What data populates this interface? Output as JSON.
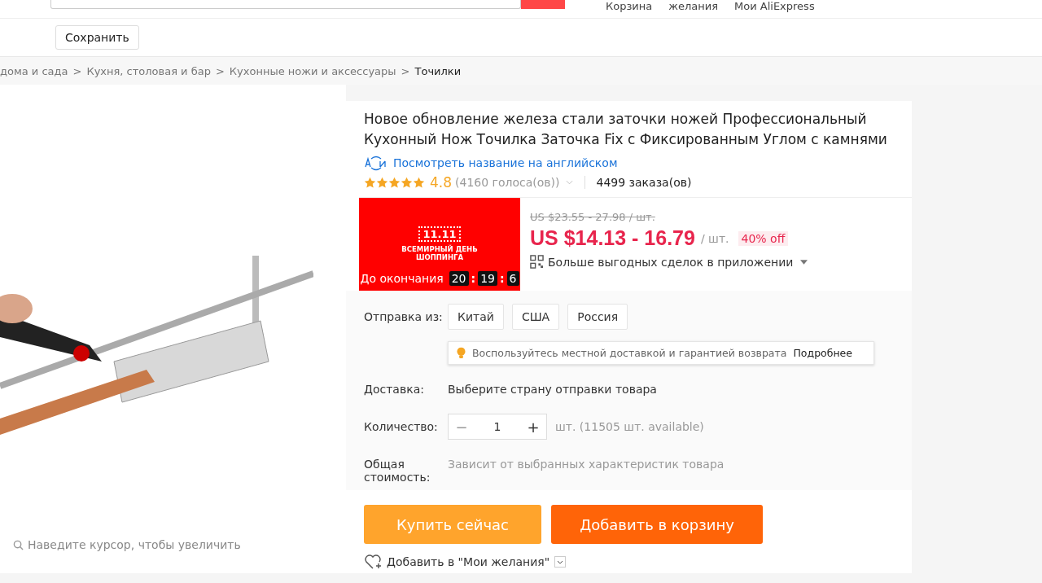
{
  "header": {
    "links": [
      {
        "label": "Корзина"
      },
      {
        "label": "желания"
      },
      {
        "label": "Мои AliExpress"
      }
    ]
  },
  "toolbar": {
    "save_button": "Сохранить"
  },
  "breadcrumb": [
    "дома и сада",
    "Кухня, столовая и бар",
    "Кухонные ножи и аксессуары",
    "Точилки"
  ],
  "breadcrumb_separator": ">",
  "gallery": {
    "zoom_hint": "Наведите курсор, чтобы увеличить"
  },
  "product": {
    "title": "Новое обновление железа стали заточки ножей Профессиональный Кухонный Нож Точилка Заточка Fix с Фиксированным Углом с камнями",
    "translate_link": "Посмотреть название на английском",
    "stars": 5,
    "rating": "4.8",
    "votes": "(4160 голоса(ов))",
    "orders": "4499 заказа(ов)"
  },
  "promo": {
    "badge": "11.11",
    "event": "ВСЕМИРНЫЙ ДЕНЬ ШОППИНГА",
    "countdown_label": "До окончания",
    "countdown": [
      "20",
      "19",
      "6"
    ],
    "countdown_separator": ":"
  },
  "price": {
    "old": "US $23.55 - 27.98 / шт.",
    "current": "US $14.13 - 16.79",
    "unit": "/ шт.",
    "discount": "40% off",
    "app_deals": "Больше выгодных сделок в приложении"
  },
  "options": {
    "ship_from_label": "Отправка из:",
    "countries": [
      {
        "label": "Китай",
        "selected": false
      },
      {
        "label": "США",
        "selected": false
      },
      {
        "label": "Россия",
        "selected": false
      }
    ],
    "tip": "Воспользуйтесь местной доставкой и гарантией возврата",
    "tip_link": "Подробнее",
    "delivery_label": "Доставка:",
    "delivery_value": "Выберите страну отправки товара",
    "quantity_label": "Количество:",
    "quantity": "1",
    "minus": "−",
    "plus": "+",
    "stock": "шт. (11505 шт. available)",
    "total_label": "Общая стоимость:",
    "total_value": "Зависит от выбранных характеристик товара"
  },
  "actions": {
    "buy_now": "Купить сейчас",
    "add_to_cart": "Добавить в корзину",
    "wishlist": "Добавить в \"Мои желания\""
  }
}
